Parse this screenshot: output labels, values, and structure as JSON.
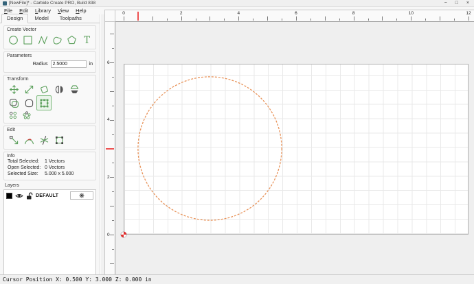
{
  "window": {
    "title": "[NewFile]* - Carbide Create PRO, Build 838",
    "controls": [
      {
        "name": "minimize",
        "glyph": "−"
      },
      {
        "name": "maximize",
        "glyph": "□"
      },
      {
        "name": "close",
        "glyph": "×"
      }
    ]
  },
  "menu": {
    "items": [
      "File",
      "Edit",
      "Library",
      "View",
      "Help"
    ]
  },
  "tabs": [
    {
      "label": "Design",
      "active": true
    },
    {
      "label": "Model",
      "active": false
    },
    {
      "label": "Toolpaths",
      "active": false
    }
  ],
  "panels": {
    "create_vector": {
      "title": "Create Vector",
      "tools": [
        "circle-tool",
        "rectangle-tool",
        "polyline-tool",
        "curve-tool",
        "polygon-tool",
        "text-tool"
      ]
    },
    "parameters": {
      "title": "Parameters",
      "radius_label": "Radius",
      "radius_value": "2.5000",
      "unit": "in"
    },
    "transform": {
      "title": "Transform",
      "rows": [
        [
          "move",
          "scale",
          "rotate",
          "mirror",
          "flip"
        ],
        [
          "offset",
          "fillet",
          "align"
        ],
        [
          "grid-array",
          "circular-array"
        ]
      ],
      "active_tool": "align"
    },
    "edit": {
      "title": "Edit",
      "tools": [
        "select-arrow",
        "trim",
        "knife",
        "edit-nodes"
      ]
    },
    "info": {
      "title": "Info",
      "rows": [
        {
          "label": "Total Selected:",
          "value": "1 Vectors"
        },
        {
          "label": "Open Selected:",
          "value": "0 Vectors"
        },
        {
          "label": "Selected Size:",
          "value": "5.000 x 5.000"
        }
      ]
    },
    "layers": {
      "title": "Layers",
      "items": [
        {
          "name": "DEFAULT",
          "color": "#000000",
          "visible": true,
          "locked": false
        }
      ],
      "settings_icon": "gear-icon"
    }
  },
  "canvas": {
    "units": "in",
    "ruler_h": {
      "labels": [
        0,
        2,
        4,
        6,
        8,
        10,
        12
      ]
    },
    "ruler_v": {
      "labels": [
        6,
        4,
        2,
        0
      ]
    },
    "shape": {
      "type": "circle",
      "center_x_in": 3.0,
      "center_y_in": 3.0,
      "radius_in": 2.5,
      "stroke_color": "#e8935a",
      "style": "dashed"
    },
    "cursor_marker": {
      "x_in": 0.5,
      "y_in": 3.0
    },
    "origin_marker": {
      "x_in": 0,
      "y_in": 0,
      "color": "#e03030"
    }
  },
  "status_bar": {
    "text": "Cursor Position X: 0.500 Y: 3.000 Z: 0.000 in"
  },
  "colors": {
    "accent_green": "#5ca05c",
    "selection_orange": "#e8935a",
    "marker_red": "#ee5050"
  }
}
